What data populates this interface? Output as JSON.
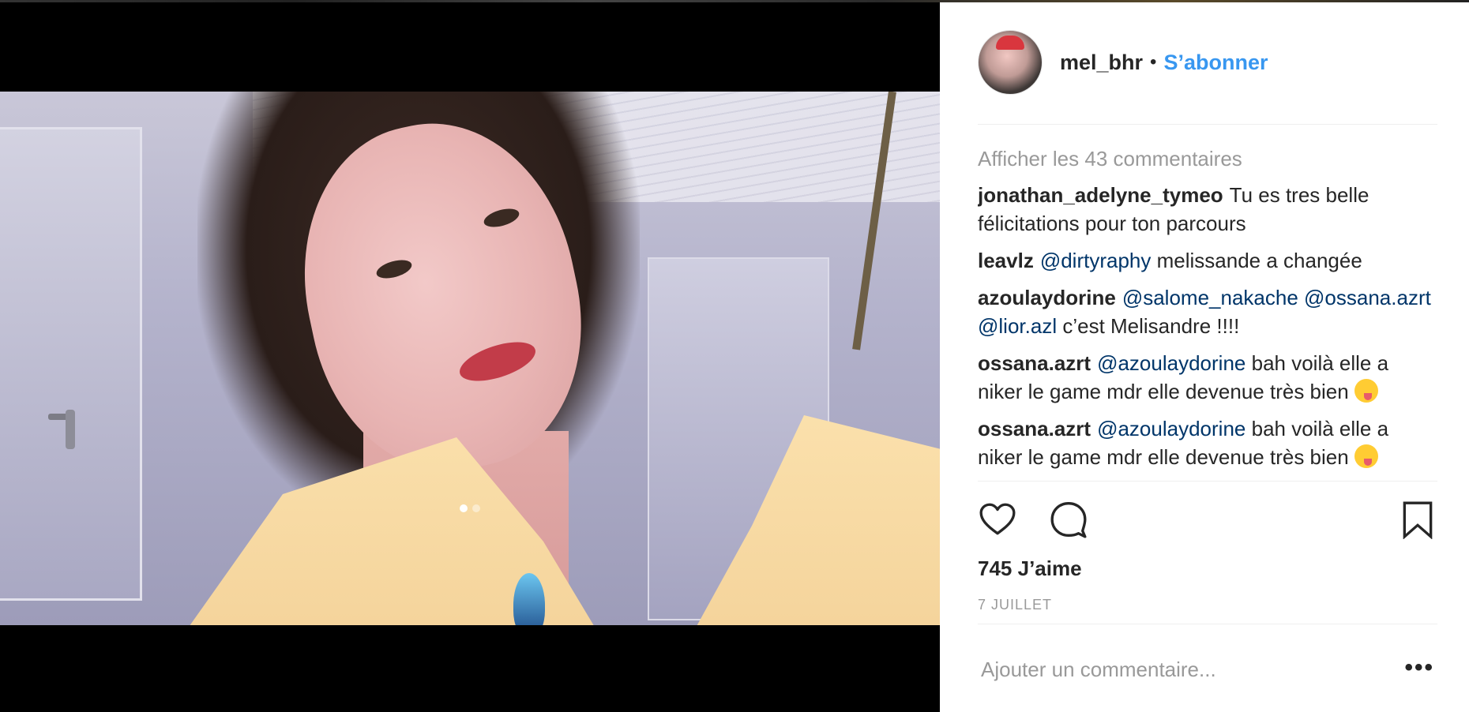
{
  "post": {
    "username": "mel_bhr",
    "separator": "•",
    "follow_label": "S’abonner",
    "view_all_comments": "Afficher les 43 commentaires",
    "comments": [
      {
        "user": "jonathan_adelyne_tymeo",
        "text": "Tu es tres belle félicitations pour ton parcours"
      },
      {
        "user": "leavlz",
        "mention": "@dirtyraphy",
        "text": "melissande a changée"
      },
      {
        "user": "azoulaydorine",
        "mentions": [
          "@salome_nakache",
          "@ossana.azrt",
          "@lior.azl"
        ],
        "text": "c’est Melisandre !!!!"
      },
      {
        "user": "ossana.azrt",
        "mention": "@azoulaydorine",
        "text": "bah voilà elle a niker le game mdr elle devenue très bien"
      },
      {
        "user": "ossana.azrt",
        "mention": "@azoulaydorine",
        "text": "bah voilà elle a niker le game mdr elle devenue très bien"
      }
    ],
    "likes": "745 J’aime",
    "date": "7 JUILLET",
    "add_comment_placeholder": "Ajouter un commentaire...",
    "more_label": "•••",
    "carousel": {
      "count": 2,
      "active_index": 0
    },
    "icons": {
      "like": "heart-icon",
      "comment": "comment-bubble-icon",
      "save": "bookmark-icon"
    },
    "colors": {
      "link_blue": "#3897f0",
      "mention": "#003569",
      "muted": "#999999",
      "text": "#262626"
    }
  }
}
